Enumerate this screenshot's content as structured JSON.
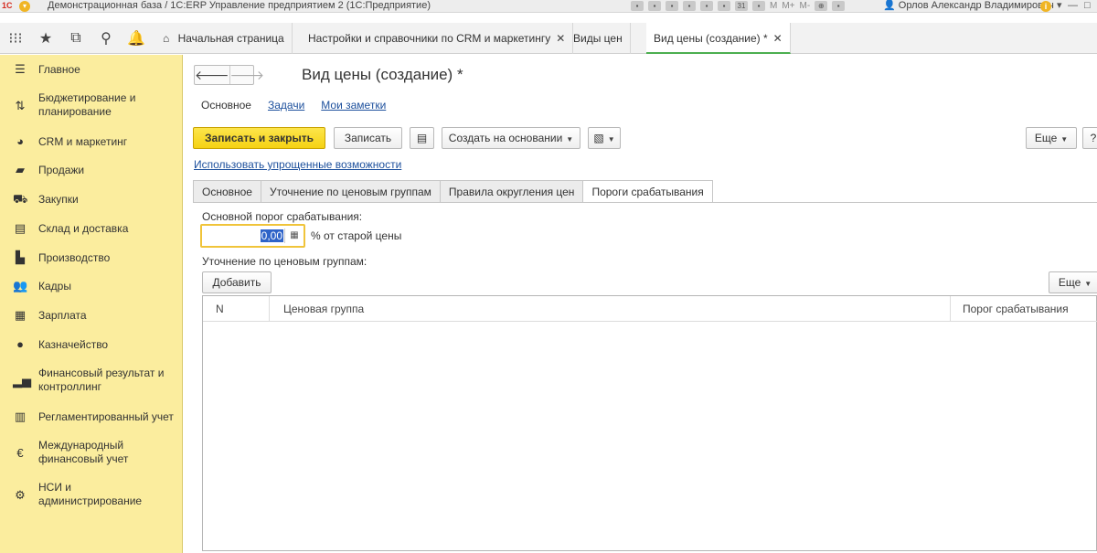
{
  "titlebar": {
    "logo": "1С",
    "title": "Демонстрационная база / 1С:ERP Управление предприятием 2  (1С:Предприятие)",
    "tools": [
      "M",
      "M+",
      "M-"
    ],
    "user": "Орлов Александр Владимирович",
    "info": "i"
  },
  "tabs": {
    "home": "Начальная страница",
    "items": [
      {
        "label": "Настройки и справочники по CRM и маркетингу",
        "close": "✕"
      },
      {
        "label": "Виды цен"
      },
      {
        "label": "Вид цены (создание) *",
        "close": "✕"
      }
    ]
  },
  "sidebar": {
    "items": [
      {
        "label": "Главное",
        "icon": "menu-icon"
      },
      {
        "label": "Бюджетирование и планирование",
        "icon": "budget-icon"
      },
      {
        "label": "CRM и маркетинг",
        "icon": "crm-icon"
      },
      {
        "label": "Продажи",
        "icon": "bag-icon"
      },
      {
        "label": "Закупки",
        "icon": "cart-icon"
      },
      {
        "label": "Склад и доставка",
        "icon": "warehouse-icon"
      },
      {
        "label": "Производство",
        "icon": "factory-icon"
      },
      {
        "label": "Кадры",
        "icon": "people-icon"
      },
      {
        "label": "Зарплата",
        "icon": "calculator-icon"
      },
      {
        "label": "Казначейство",
        "icon": "coin-icon"
      },
      {
        "label": "Финансовый результат и контроллинг",
        "icon": "chart-icon"
      },
      {
        "label": "Регламентированный учет",
        "icon": "document-icon"
      },
      {
        "label": "Международный финансовый учет",
        "icon": "currency-icon"
      },
      {
        "label": "НСИ и администрирование",
        "icon": "gear-icon"
      }
    ]
  },
  "form": {
    "title": "Вид цены (создание) *",
    "subnav": {
      "current": "Основное",
      "links": [
        "Задачи",
        "Мои заметки"
      ]
    },
    "toolbar": {
      "save_close": "Записать и закрыть",
      "save": "Записать",
      "create_based": "Создать на основании",
      "more": "Еще",
      "help": "?"
    },
    "simplified_link": "Использовать упрощенные возможности",
    "tabs": [
      "Основное",
      "Уточнение по ценовым группам",
      "Правила округления цен",
      "Пороги срабатывания"
    ],
    "active_tab": 3,
    "threshold": {
      "label": "Основной порог срабатывания:",
      "value": "0,00",
      "unit": "% от старой цены"
    },
    "groups": {
      "label": "Уточнение по ценовым группам:",
      "add": "Добавить",
      "more": "Еще",
      "columns": [
        "N",
        "Ценовая группа",
        "Порог срабатывания"
      ],
      "rows": []
    }
  }
}
